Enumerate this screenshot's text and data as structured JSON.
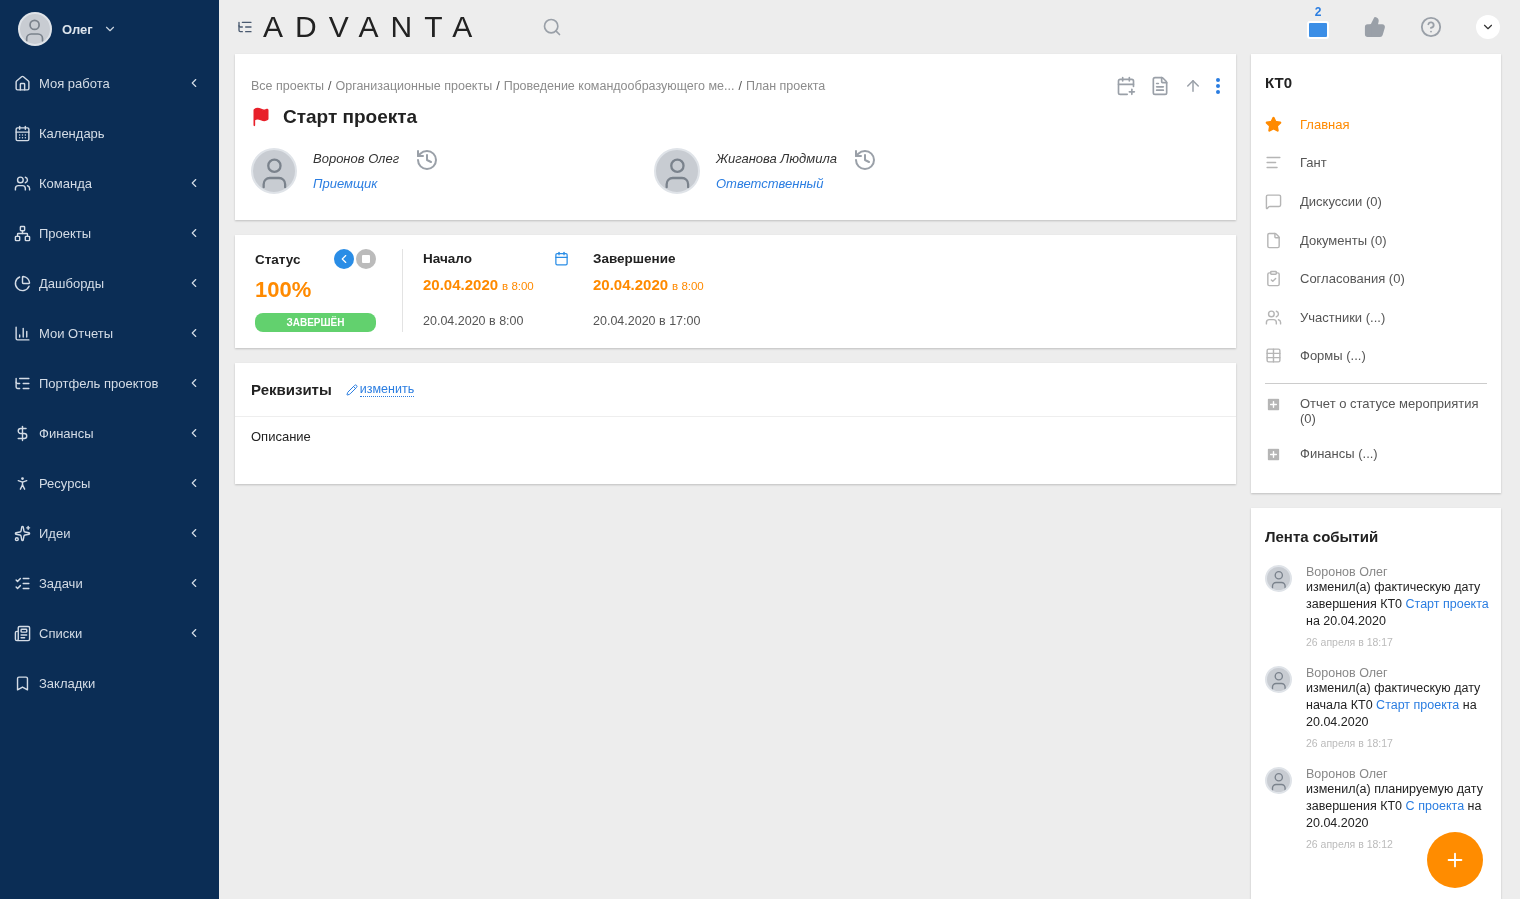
{
  "user": {
    "name": "Олег"
  },
  "sidebar": {
    "items": [
      {
        "label": "Моя работа",
        "has_submenu": true
      },
      {
        "label": "Календарь",
        "has_submenu": false
      },
      {
        "label": "Команда",
        "has_submenu": true
      },
      {
        "label": "Проекты",
        "has_submenu": true
      },
      {
        "label": "Дашборды",
        "has_submenu": true
      },
      {
        "label": "Мои Отчеты",
        "has_submenu": true
      },
      {
        "label": "Портфель проектов",
        "has_submenu": true
      },
      {
        "label": "Финансы",
        "has_submenu": true
      },
      {
        "label": "Ресурсы",
        "has_submenu": true
      },
      {
        "label": "Идеи",
        "has_submenu": true
      },
      {
        "label": "Задачи",
        "has_submenu": true
      },
      {
        "label": "Списки",
        "has_submenu": true
      },
      {
        "label": "Закладки",
        "has_submenu": false
      }
    ]
  },
  "topbar": {
    "logo": "ADVANTA",
    "mail_count": "2"
  },
  "header": {
    "breadcrumb_separator": "/",
    "breadcrumbs": [
      "Все проекты",
      "Организационные проекты",
      "Проведение командообразующего ме...",
      "План проекта"
    ],
    "title": "Старт проекта",
    "people": [
      {
        "name": "Воронов Олег",
        "role": "Приемщик"
      },
      {
        "name": "Жиганова Людмила",
        "role": "Ответственный"
      }
    ]
  },
  "status": {
    "label": "Статус",
    "percent": "100%",
    "badge": "ЗАВЕРШЁН",
    "dates": [
      {
        "label": "Начало",
        "plan_date": "20.04.2020",
        "plan_time": "в 8:00",
        "actual": "20.04.2020 в 8:00"
      },
      {
        "label": "Завершение",
        "plan_date": "20.04.2020",
        "plan_time": "в 8:00",
        "actual": "20.04.2020 в 17:00"
      }
    ]
  },
  "details": {
    "title": "Реквизиты",
    "edit_link": "изменить",
    "description_label": "Описание"
  },
  "right_nav": {
    "title": "КТ0",
    "items": [
      {
        "label": "Главная",
        "selected": true
      },
      {
        "label": "Гант",
        "selected": false
      },
      {
        "label": "Дискуссии (0)",
        "selected": false
      },
      {
        "label": "Документы (0)",
        "selected": false
      },
      {
        "label": "Согласования (0)",
        "selected": false
      },
      {
        "label": "Участники (...)",
        "selected": false
      },
      {
        "label": "Формы (...)",
        "selected": false
      }
    ],
    "extra_items": [
      {
        "label": "Отчет о статусе мероприятия (0)"
      },
      {
        "label": "Финансы (...)"
      }
    ]
  },
  "feed": {
    "title": "Лента событий",
    "events": [
      {
        "author": "Воронов Олег",
        "parts": [
          {
            "kind": "text",
            "text": "изменил(а) фактическую дату завершения КТ0 "
          },
          {
            "kind": "link",
            "text": "Старт проекта"
          },
          {
            "kind": "text",
            "text": " на 20.04.2020"
          }
        ],
        "time": "26 апреля в 18:17"
      },
      {
        "author": "Воронов Олег",
        "parts": [
          {
            "kind": "text",
            "text": "изменил(а) фактическую дату начала КТ0 "
          },
          {
            "kind": "link",
            "text": "Старт проекта"
          },
          {
            "kind": "text",
            "text": " на 20.04.2020"
          }
        ],
        "time": "26 апреля в 18:17"
      },
      {
        "author": "Воронов Олег",
        "parts": [
          {
            "kind": "text",
            "text": "изменил(а) планируемую дату завершения КТ0 "
          },
          {
            "kind": "link",
            "text": "С"
          },
          {
            "kind": "link",
            "text": "проекта"
          },
          {
            "kind": "text",
            "text": " на 20.04.2020"
          }
        ],
        "time": "26 апреля в 18:12"
      }
    ]
  }
}
